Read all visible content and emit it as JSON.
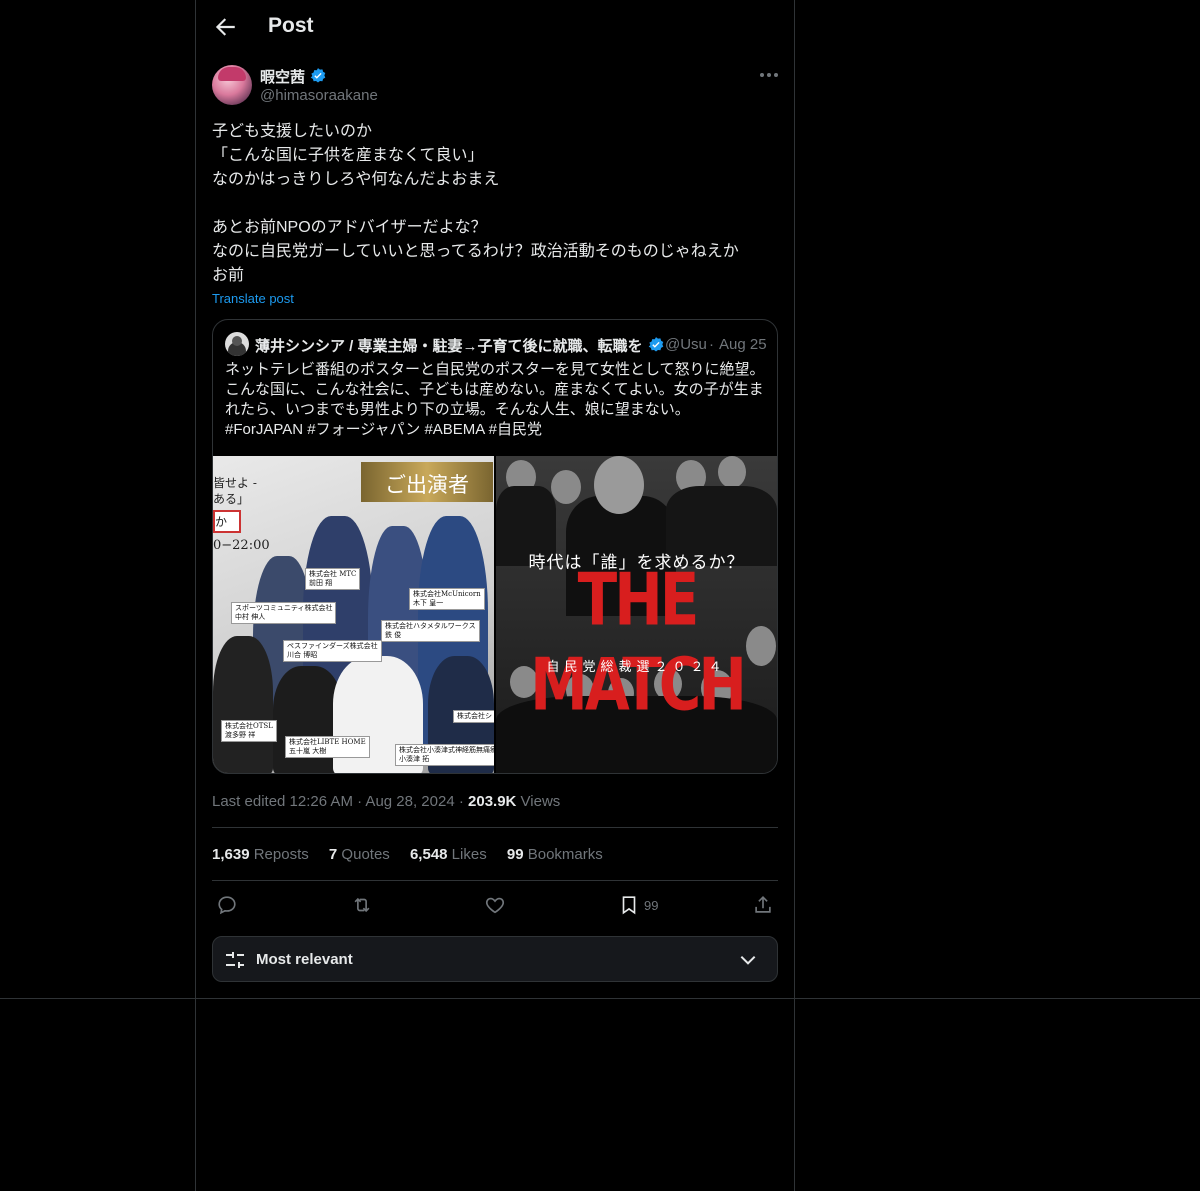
{
  "header": {
    "title": "Post"
  },
  "post": {
    "display_name": "暇空茜",
    "handle": "@himasoraakane",
    "body": "子ども支援したいのか\n「こんな国に子供を産まなくて良い」\nなのかはっきりしろや何なんだよおまえ\n\nあとお前NPOのアドバイザーだよな？\nなのに自民党ガーしていいと思ってるわけ？政治活動そのものじゃねえか\nお前",
    "translate_label": "Translate post"
  },
  "quote": {
    "display_name": "薄井シンシア / 専業主婦・駐妻→子育て後に就職、転職を",
    "handle": "@Usu",
    "separator": "·",
    "date": "Aug 25",
    "text": "ネットテレビ番組のポスターと自民党のポスターを見て女性として怒りに絶望。\nこんな国に、こんな社会に、子どもは産めない。産まなくてよい。女の子が生まれたら、いつまでも男性より下の立場。そんな人生、娘に望まない。\n#ForJAPAN #フォージャパン #ABEMA #自民党",
    "image_left": {
      "plate": "ご出演者",
      "lines": [
        "皆せよ -",
        "ある」",
        "か",
        "0−22:00"
      ],
      "labels": [
        "株式会社 MTC\n前田 翔",
        "株式会社McUnicorn\n木下 皇一",
        "スポーツコミュニティ株式会社\n中村 伸人",
        "株式会社ハタメタルワークス\n鉄 俊",
        "ペスファインダーズ株式会社\n川合 博昭",
        "株式会社OTSL\n渡多野 祥",
        "株式会社LIBTE HOME\n五十嵐 大樹",
        "株式会社小湊津式神経筋無痛療法研究所\n小湊津 拓",
        "株式会社シ"
      ]
    },
    "image_right": {
      "tagline": "時代は「誰」を求めるか？",
      "title": "THE MATCH",
      "subtitle": "自民党総裁選２０２４"
    }
  },
  "meta": {
    "edited": "Last edited 12:26 AM · Aug 28, 2024 · ",
    "views_count": "203.9K",
    "views_label": " Views"
  },
  "stats": [
    {
      "count": "1,639",
      "label": " Reposts"
    },
    {
      "count": "7",
      "label": " Quotes"
    },
    {
      "count": "6,548",
      "label": " Likes"
    },
    {
      "count": "99",
      "label": " Bookmarks"
    }
  ],
  "actions": {
    "bookmark_count": "99"
  },
  "sort": {
    "label": "Most relevant"
  },
  "icons": {
    "verified_color": "#1d9bf0",
    "back": "arrow-left-icon",
    "more": "more-dots-icon",
    "reply": "reply-icon",
    "repost": "repost-icon",
    "like": "heart-icon",
    "bookmark": "bookmark-icon",
    "share": "share-icon",
    "sort": "sliders-icon",
    "chevron": "chevron-down-icon"
  }
}
